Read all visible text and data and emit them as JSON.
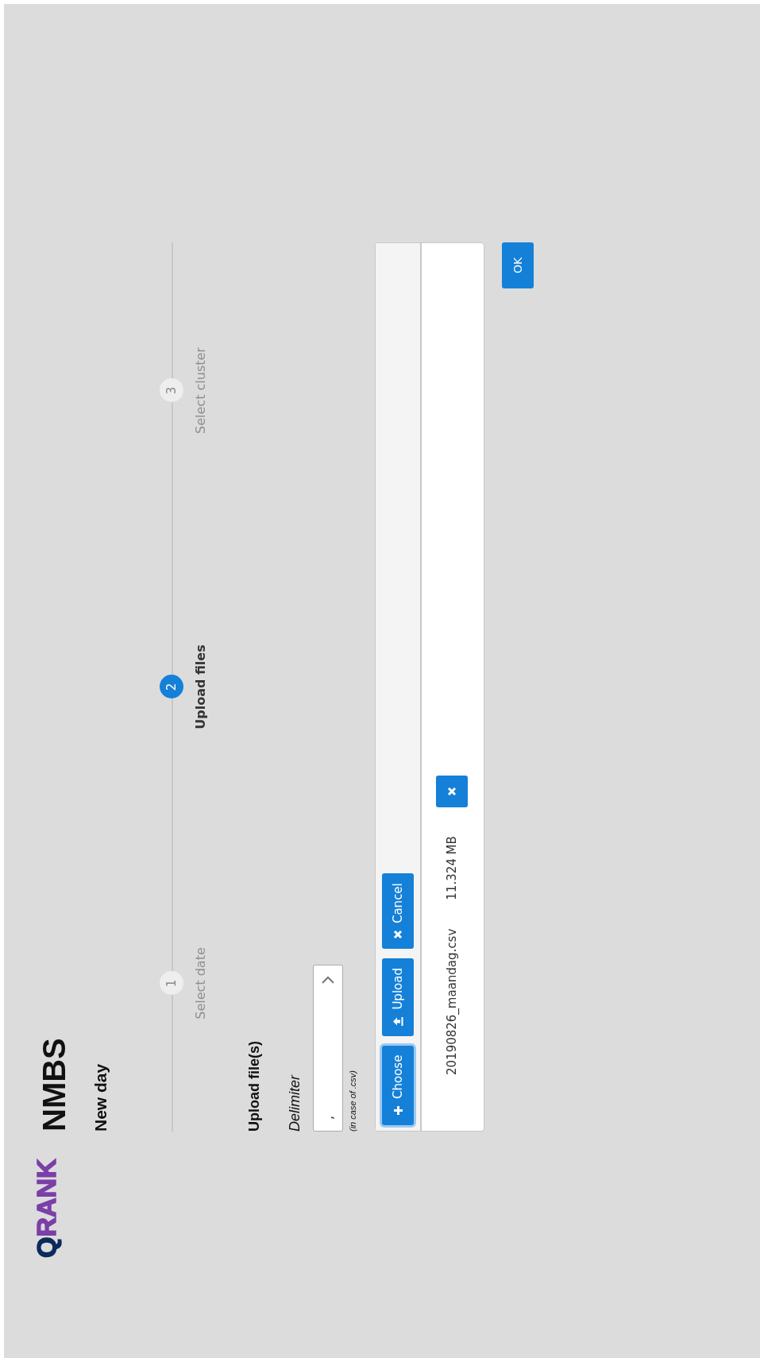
{
  "logo": {
    "first": "Q",
    "rest": "RANK"
  },
  "brand": "NMBS",
  "page_title": "New day",
  "steps": [
    {
      "number": "1",
      "label": "Select date",
      "selected": false
    },
    {
      "number": "2",
      "label": "Upload files",
      "selected": true
    },
    {
      "number": "3",
      "label": "Select cluster",
      "selected": false
    }
  ],
  "section_title": "Upload file(s)",
  "delimiter": {
    "label": "Delimiter",
    "value": ",",
    "hint": "(in case of .csv)"
  },
  "uploader": {
    "buttons": [
      {
        "kind": "choose",
        "label": "Choose",
        "focused": true
      },
      {
        "kind": "upload",
        "label": "Upload",
        "focused": false
      },
      {
        "kind": "cancel",
        "label": "Cancel",
        "focused": false
      }
    ],
    "files": [
      {
        "name": "20190826_maandag.csv",
        "size": "11.324 MB"
      }
    ]
  },
  "ok_button": "OK"
}
